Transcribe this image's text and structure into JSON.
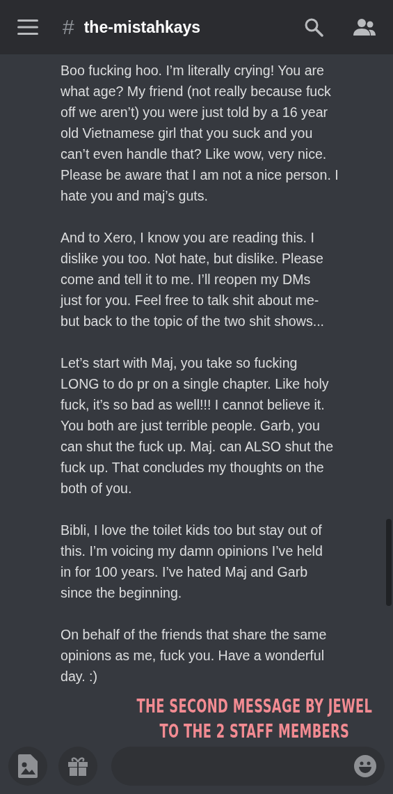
{
  "header": {
    "channel_symbol": "#",
    "channel_name": "the-mistahkays"
  },
  "message": {
    "paragraphs": [
      {
        "lines": [
          "Boo fucking hoo. I’m literally crying! You are",
          "what age? My friend (not really because fuck",
          "off we aren’t) you were just told by a 16 year",
          "old Vietnamese girl that you suck and you",
          "can’t even handle that? Like wow, very nice.",
          "Please be aware that I am not a nice person. I",
          "hate you and maj’s guts."
        ]
      },
      {
        "lines": [
          "And to Xero, I know you are reading this. I",
          "dislike you too. Not hate, but dislike. Please",
          "come and tell it to me. I’ll reopen my DMs",
          "just for you. Feel free to talk shit about me-",
          "but back to the topic of the two shit shows..."
        ]
      },
      {
        "lines": [
          "Let’s start with Maj, you take so fucking",
          "LONG to do pr on a single chapter. Like holy",
          "fuck, it’s so bad as well!!! I cannot believe it.",
          "You both are just terrible people. Garb, you",
          "can shut the fuck up. Maj. can ALSO shut the",
          "fuck up. That concludes my thoughts on the",
          "both of you."
        ]
      },
      {
        "lines": [
          "Bibli, I love the toilet kids too but stay out of",
          "this. I’m voicing my damn opinions I’ve held",
          "in for 100 years. I’ve hated Maj and Garb",
          "since the beginning."
        ]
      },
      {
        "lines": [
          "On behalf of the friends that share the same",
          "opinions as me, fuck you. Have a wonderful",
          "day. :)"
        ]
      }
    ]
  },
  "caption": {
    "lines": [
      "THE SECOND MESSAGE BY JEWEL",
      "TO THE 2 STAFF MEMBERS"
    ]
  }
}
